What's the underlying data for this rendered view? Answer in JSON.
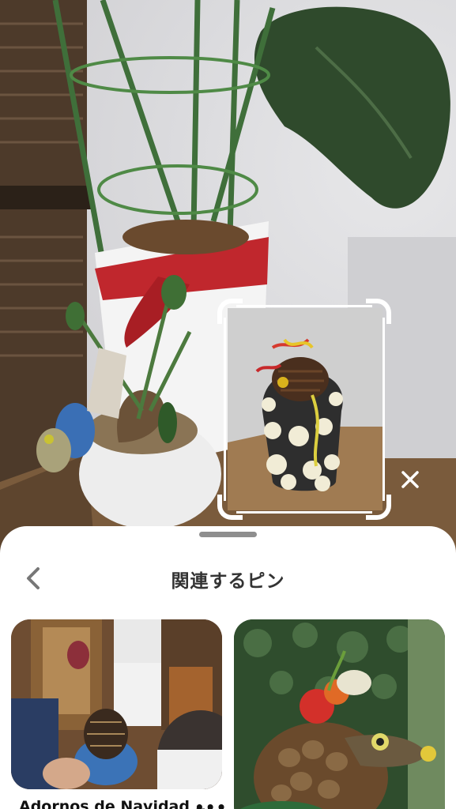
{
  "sheet": {
    "title": "関連するピン",
    "back_icon": "chevron-left-icon"
  },
  "overlay": {
    "close_icon": "close-icon"
  },
  "pins": [
    {
      "caption": "Adornos de Navidad ...",
      "more_label": "•••"
    },
    {
      "caption": ""
    }
  ]
}
